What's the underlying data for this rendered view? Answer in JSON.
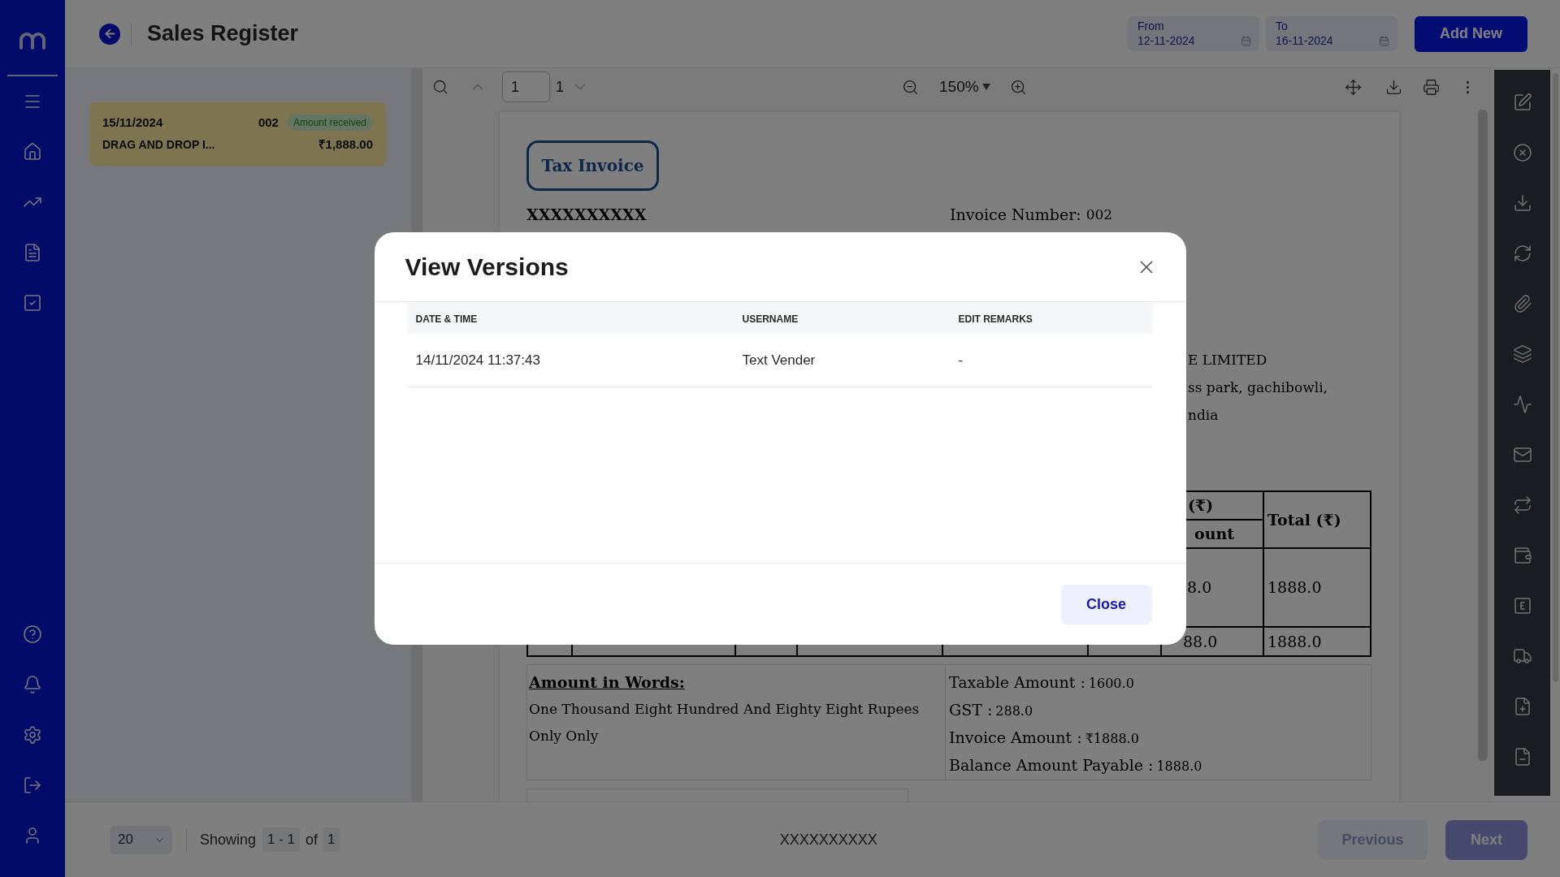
{
  "header": {
    "title": "Sales Register",
    "date_range": [
      {
        "label": "From",
        "value": "12-11-2024"
      },
      {
        "label": "To",
        "value": "16-11-2024"
      }
    ],
    "add_button": "Add New"
  },
  "invoices": [
    {
      "date": "15/11/2024",
      "number": "002",
      "status": "Amount received",
      "party": "DRAG AND DROP I...",
      "amount": "₹1,888.00",
      "selected": true
    }
  ],
  "viewer": {
    "page": "1",
    "page_count": "1",
    "zoom": "150%",
    "document": {
      "badge": "Tax Invoice",
      "seller": "XXXXXXXXXX",
      "invoice_number_label": "Invoice Number:",
      "invoice_number": "002",
      "address_lines": [
        "E LIMITED",
        "ss park, gachibowli,",
        "ndia"
      ],
      "table": {
        "header_top": "(₹)",
        "header_bottom": "ount",
        "header_total": "Total (₹)",
        "rows": [
          {
            "column_7": "8.0",
            "column_8": "1888.0"
          },
          {
            "column_7": "88.0",
            "column_8": "1888.0"
          }
        ]
      },
      "amount_in_words": {
        "title": "Amount in Words:",
        "text": "One Thousand Eight Hundred And Eighty Eight Rupees Only Only"
      },
      "totals": [
        {
          "label": "Taxable Amount :",
          "value": "1600.0"
        },
        {
          "label": "GST :",
          "value": "288.0"
        },
        {
          "label": "Invoice Amount :",
          "value": "₹1888.0"
        },
        {
          "label": "Balance Amount Payable :",
          "value": "1888.0"
        }
      ]
    }
  },
  "footer": {
    "page_size": "20",
    "showing_label": "Showing",
    "range": "1 - 1",
    "of_label": "of",
    "total": "1",
    "document_name": "XXXXXXXXXX",
    "previous": {
      "label": "Previous",
      "disabled": true
    },
    "next": {
      "label": "Next",
      "disabled": true
    }
  },
  "modal": {
    "title": "View Versions",
    "columns": [
      "DATE & TIME",
      "USERNAME",
      "EDIT REMARKS"
    ],
    "rows": [
      [
        "14/11/2024 11:37:43",
        "Text Vender",
        "-"
      ]
    ],
    "close_button": "Close"
  }
}
